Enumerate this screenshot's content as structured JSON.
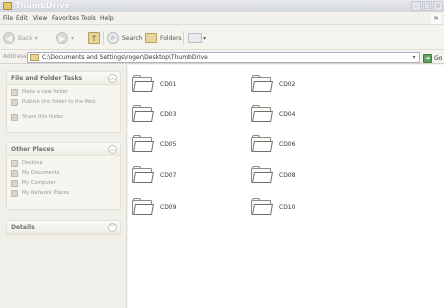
{
  "window": {
    "title": "ThumbDrive"
  },
  "menu": [
    "File",
    "Edit",
    "View",
    "Favorites",
    "Tools",
    "Help"
  ],
  "toolbar": {
    "back": "Back",
    "search": "Search",
    "folders": "Folders"
  },
  "address": {
    "label": "Address",
    "path": "C:\\Documents and Settings\\roger\\Desktop\\ThumbDrive",
    "go": "Go"
  },
  "panels": {
    "file_folder_tasks": {
      "title": "File and Folder Tasks",
      "items": [
        "Make a new folder",
        "Publish this folder to the Web",
        "Share this folder"
      ]
    },
    "other_places": {
      "title": "Other Places",
      "items": [
        "Desktop",
        "My Documents",
        "My Computer",
        "My Network Places"
      ]
    },
    "details": {
      "title": "Details"
    }
  },
  "folders": [
    "CD01",
    "CD02",
    "CD03",
    "CD04",
    "CD05",
    "CD06",
    "CD07",
    "CD08",
    "CD09",
    "CD10"
  ]
}
